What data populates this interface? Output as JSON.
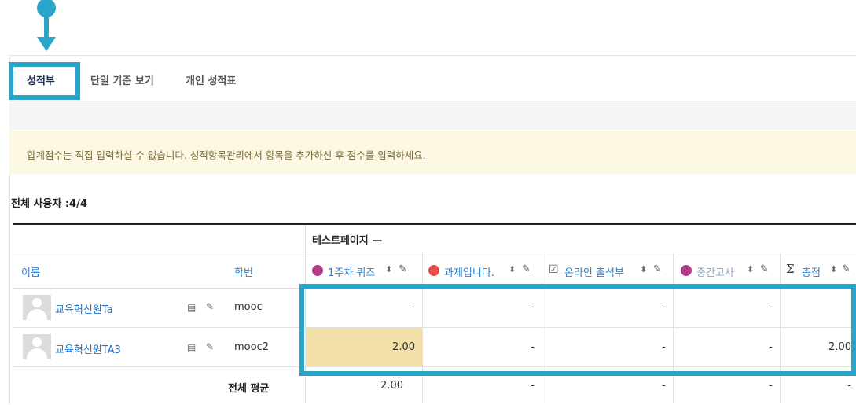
{
  "tabs": {
    "grader": "성적부",
    "single_view": "단일 기준 보기",
    "user_report": "개인 성적표"
  },
  "notice": "합계점수는 직접 입력하실 수 없습니다. 성적항목관리에서 항목을 추가하신 후 점수를 입력하세요.",
  "users_count": "전체 사용자 :4/4",
  "table": {
    "category": "테스트페이지 —",
    "col_name": "이름",
    "col_id": "학번",
    "items": [
      {
        "label": "1주차 퀴즈",
        "icon": "quiz-icon",
        "color": "#b03c8a"
      },
      {
        "label": "과제입니다.",
        "icon": "assignment-icon",
        "color": "#e1504a"
      },
      {
        "label": "온라인 출석부",
        "icon": "attendance-icon",
        "color": "#555555"
      },
      {
        "label": "중간고사",
        "icon": "quiz-icon",
        "color": "#b03c8a"
      },
      {
        "label": "총점",
        "icon": "sigma-icon",
        "color": "#333333"
      }
    ],
    "rows": [
      {
        "name": "교육혁신원Ta",
        "id": "mooc",
        "grades": [
          "-",
          "-",
          "-",
          "-",
          ""
        ]
      },
      {
        "name": "교육혁신원TA3",
        "id": "mooc2",
        "grades": [
          "2.00",
          "-",
          "-",
          "-",
          "2.00"
        ]
      }
    ],
    "avg_label": "전체 평균",
    "avg": [
      "2.00",
      "-",
      "-",
      "-",
      "-"
    ],
    "sort_glyph": "⬍",
    "edit_glyph": "✎",
    "report_glyph": "▤"
  },
  "colors": {
    "accent": "#28a5c9",
    "highlight_cell": "#f3e0a8",
    "notice_bg": "#fcf8e3",
    "link": "#1a73d4"
  }
}
